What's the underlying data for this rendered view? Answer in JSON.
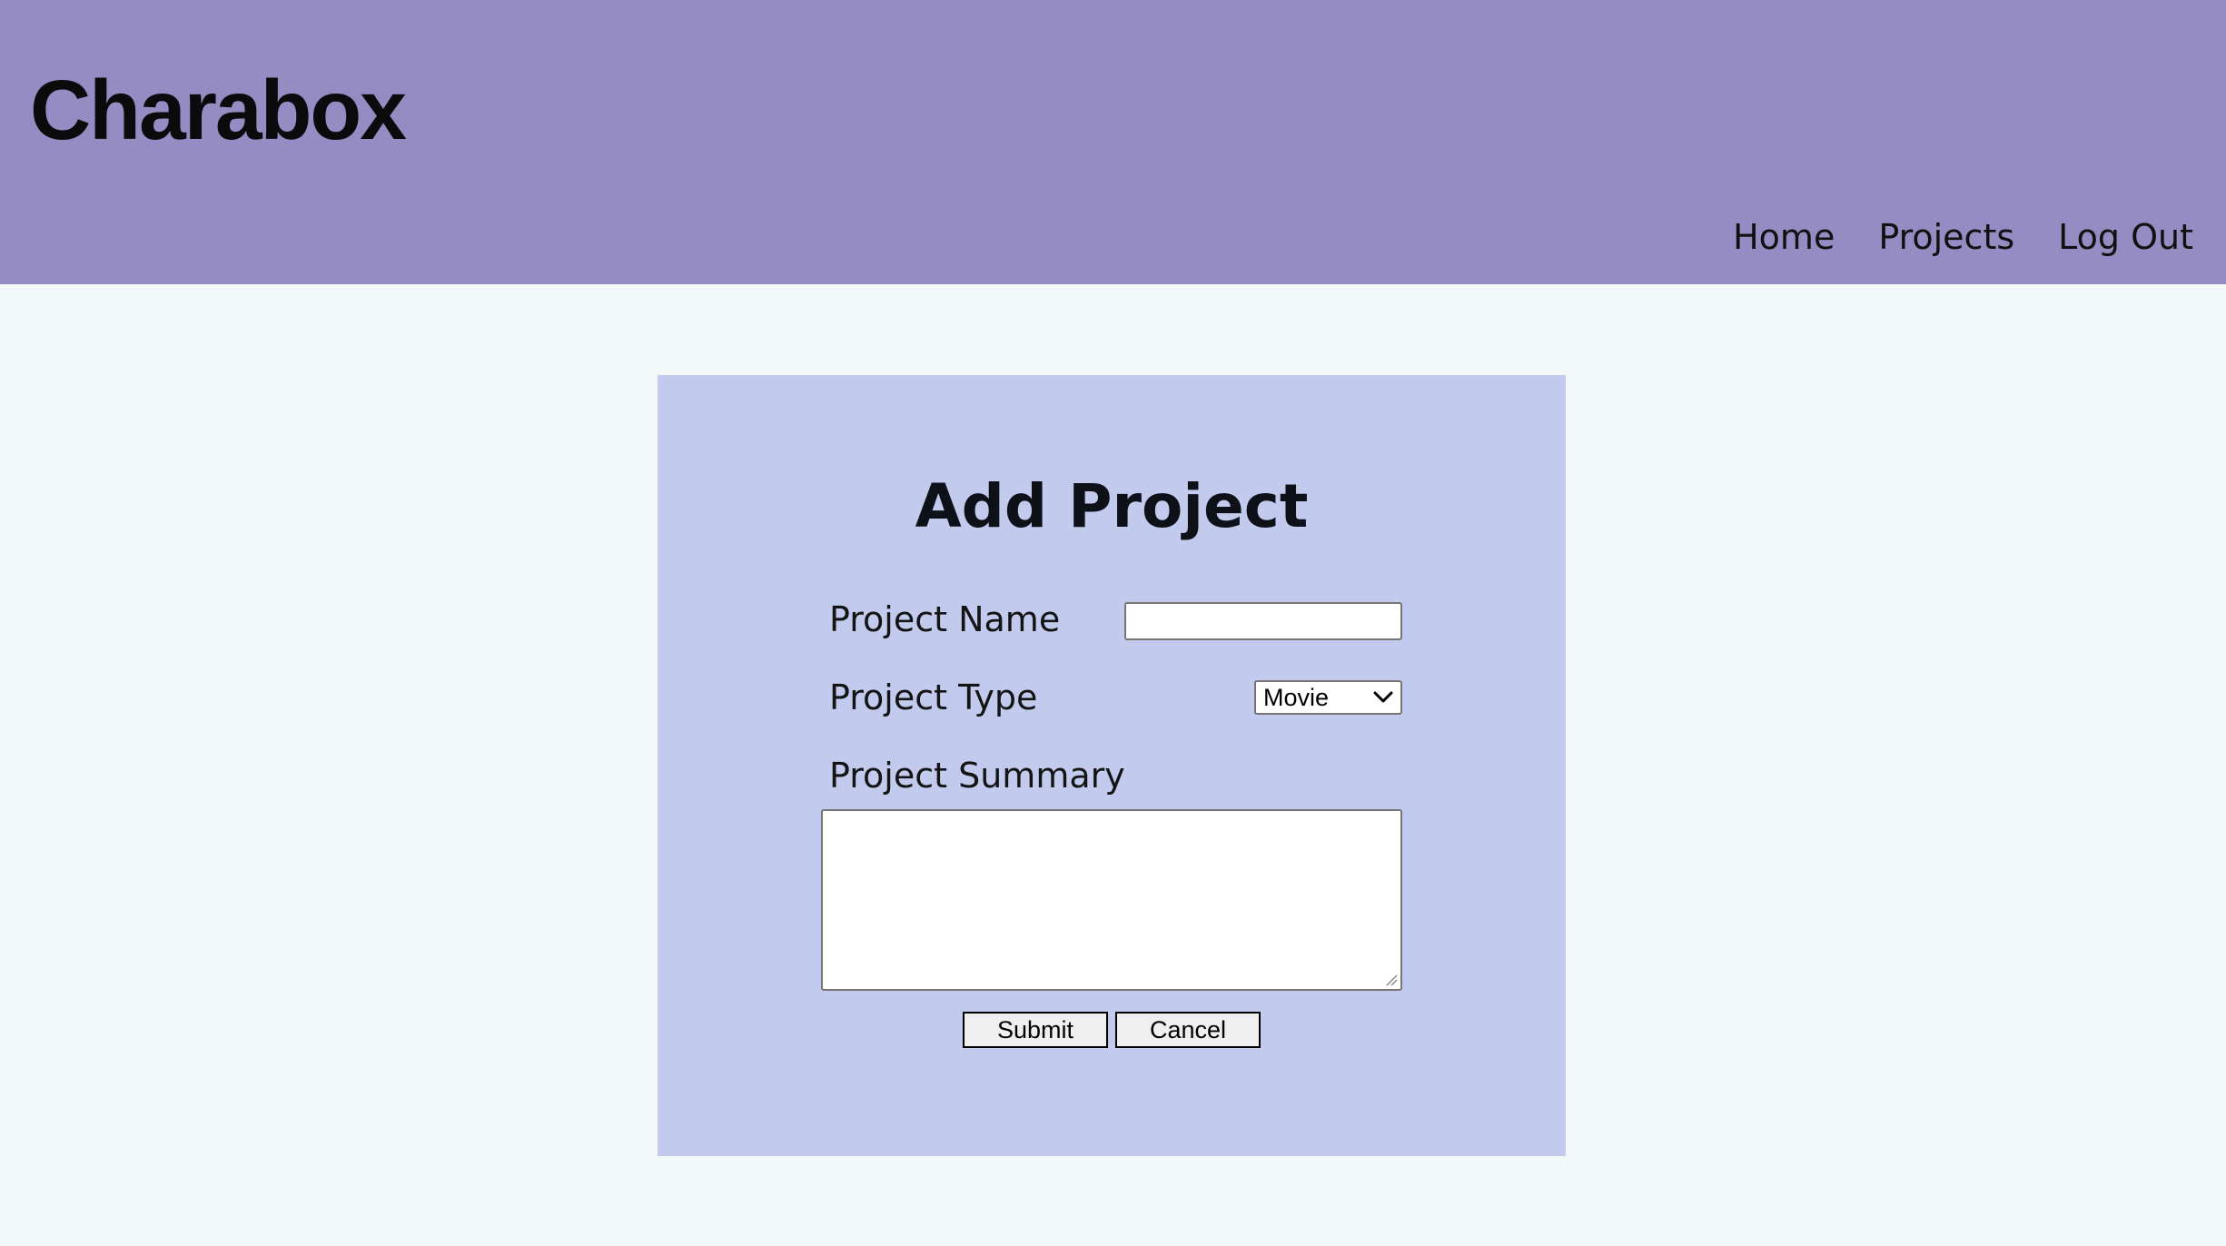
{
  "header": {
    "brand": "Charabox",
    "nav": [
      {
        "label": "Home"
      },
      {
        "label": "Projects"
      },
      {
        "label": "Log Out"
      }
    ]
  },
  "form": {
    "title": "Add Project",
    "project_name": {
      "label": "Project Name",
      "value": "",
      "placeholder": ""
    },
    "project_type": {
      "label": "Project Type",
      "selected": "Movie"
    },
    "project_summary": {
      "label": "Project Summary",
      "value": ""
    },
    "submit_label": "Submit",
    "cancel_label": "Cancel"
  },
  "colors": {
    "header_bg": "#968cc4",
    "page_bg": "#f2f8f7",
    "card_bg": "#c2cbee"
  },
  "icons": {
    "select_arrow": "chevron-down-icon",
    "resize": "resize-grip-icon"
  }
}
